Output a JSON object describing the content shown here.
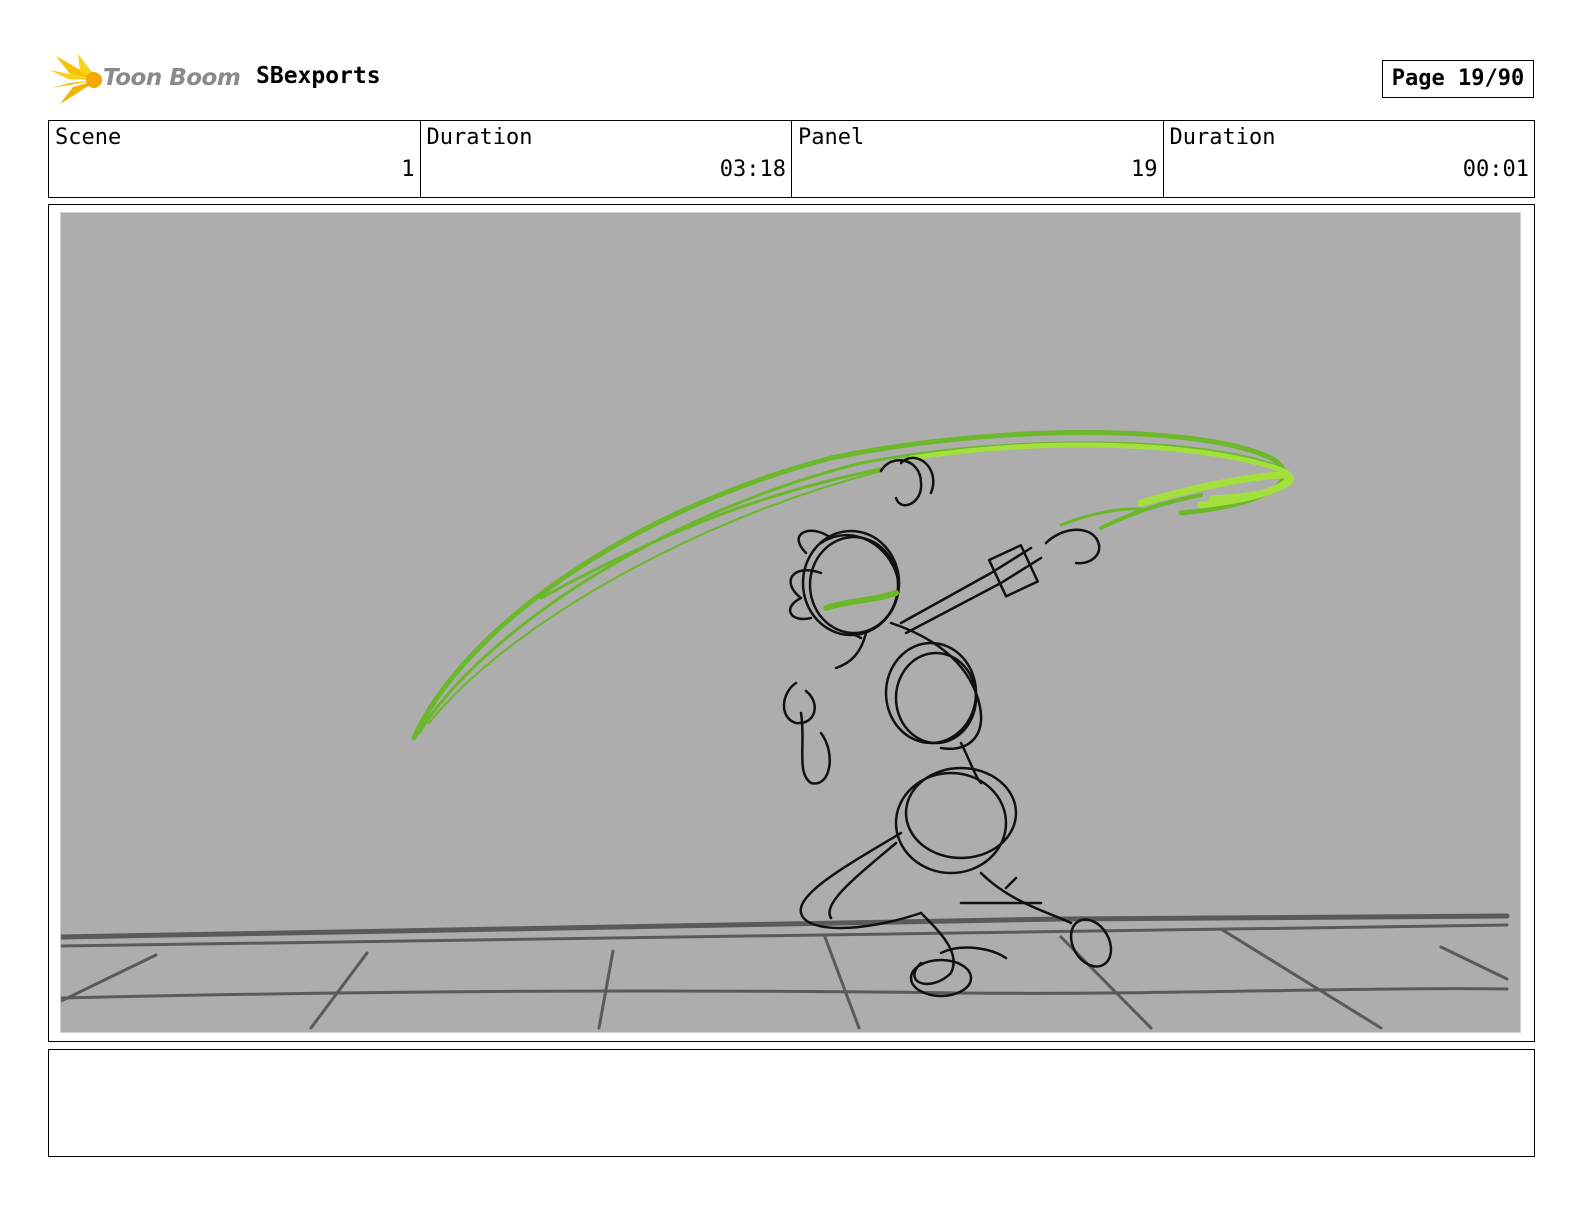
{
  "header": {
    "logo_text": "Toon Boom",
    "project_name": "SBexports",
    "page_label": "Page 19/90"
  },
  "info": {
    "scene_label": "Scene",
    "scene_value": "1",
    "scene_duration_label": "Duration",
    "scene_duration_value": "03:18",
    "panel_label": "Panel",
    "panel_value": "19",
    "panel_duration_label": "Duration",
    "panel_duration_value": "00:01"
  },
  "colors": {
    "sketch_bg": "#adadad",
    "swoosh_green": "#6bb82a",
    "swoosh_light": "#a4e03c",
    "ink": "#111111",
    "floor": "#5a5a5a",
    "logo_yellow": "#f5c400"
  },
  "notes": ""
}
